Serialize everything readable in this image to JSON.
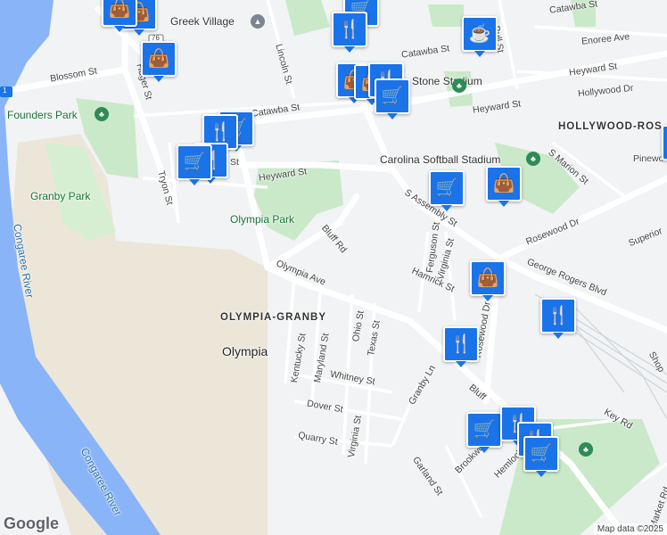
{
  "map": {
    "colors": {
      "water": "#8ab4f8",
      "park": "#c9e9c9",
      "sand": "#efe7d6",
      "road": "#ffffff",
      "pin": "#1a73e8"
    },
    "labels": {
      "greek_village": "Greek Village",
      "founders_park": "Founders Park",
      "granby_park": "Granby Park",
      "olympia_park": "Olympia Park",
      "congaree_river": "Congaree River",
      "congaree_river_2": "Congaree River",
      "olympia_granby": "OLYMPIA-GRANBY",
      "olympia": "Olympia",
      "hollywood_rose": "HOLLYWOOD-ROS",
      "carolina_softball": "Carolina Softball Stadium",
      "stone_stadium": "Stone Stadium",
      "blossom_st": "Blossom St",
      "huger_st": "Huger St",
      "tryon_st": "Tryon St",
      "lincoln_st": "Lincoln St",
      "catawba_st_1": "Catawba St",
      "catawba_st_2": "Catawba St",
      "catawba_st_3": "Catawba St",
      "heyward_st_1": "Heyward St",
      "heyward_st_2": "Heyward St",
      "heyward_st_3": "Heyward St",
      "enoree_ave": "Enoree Ave",
      "hollywood_dr": "Hollywood Dr",
      "bull_st": "Bull St",
      "s_marion_st": "S Marion St",
      "pinewood": "Pinewo",
      "s_assembly_st": "S Assembly St",
      "rosewood_dr_1": "Rosewood Dr",
      "rosewood_dr_2": "Rosewood Dr",
      "superior": "Superior",
      "ferguson_st": "Ferguson St",
      "virginia_st_1": "Virginia St",
      "virginia_st_2": "Virginia St",
      "hamrick_st": "Hamrick St",
      "george_rogers": "George Rogers Blvd",
      "bluff_rd_1": "Bluff Rd",
      "bluff_rd_2": "Bluff",
      "olympia_ave": "Olympia Ave",
      "kentucky_st": "Kentucky St",
      "maryland_st": "Maryland St",
      "ohio_st": "Ohio St",
      "texas_st": "Texas St",
      "whitney_st": "Whitney St",
      "dover_st": "Dover St",
      "quarry_st": "Quarry St",
      "granby_ln": "Granby Ln",
      "brookwood": "Brookwood",
      "garland_st": "Garland St",
      "hemlock_rd": "Hemlock Rd",
      "key_rd": "Key Rd",
      "market_rd": "Market Rd",
      "shop": "Shop",
      "st_fragment": "St",
      "i76": "76",
      "i1": "1"
    },
    "logo": "Google",
    "attribution": "Map data ©2025"
  },
  "markers": [
    {
      "type": "shopping",
      "icon": "shopping-bag-icon",
      "glyph": "👜"
    },
    {
      "type": "restaurant",
      "icon": "restaurant-icon",
      "glyph": "🍴"
    },
    {
      "type": "cafe",
      "icon": "cafe-icon",
      "glyph": "☕"
    },
    {
      "type": "grocery",
      "icon": "shopping-cart-icon",
      "glyph": "🛒"
    }
  ]
}
